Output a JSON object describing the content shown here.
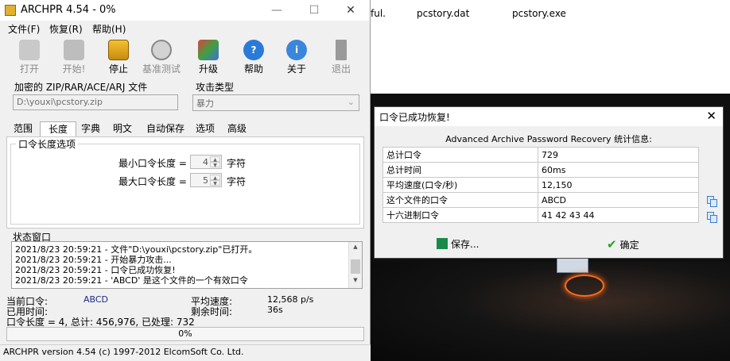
{
  "background": {
    "explorer_files": [
      "ful.",
      "pcstory.dat",
      "pcstory.exe"
    ]
  },
  "window": {
    "title": "ARCHPR 4.54 - 0%",
    "controls": {
      "minimize": "—",
      "maximize": "☐",
      "close": "✕"
    },
    "menu": [
      "文件(F)",
      "恢复(R)",
      "帮助(H)"
    ],
    "toolbar": [
      {
        "label": "打开",
        "icon": "open-folder-icon",
        "enabled": false
      },
      {
        "label": "开始!",
        "icon": "start-icon",
        "enabled": false
      },
      {
        "label": "停止",
        "icon": "stop-lock-icon",
        "enabled": true
      },
      {
        "label": "基准测试",
        "icon": "stopwatch-icon",
        "enabled": false
      },
      {
        "label": "升级",
        "icon": "upgrade-icon",
        "enabled": true
      },
      {
        "label": "帮助",
        "icon": "help-icon",
        "enabled": true
      },
      {
        "label": "关于",
        "icon": "info-icon",
        "enabled": true
      },
      {
        "label": "退出",
        "icon": "exit-door-icon",
        "enabled": false
      }
    ],
    "encrypted_file_label": "加密的 ZIP/RAR/ACE/ARJ 文件",
    "encrypted_file_value": "D:\\youxi\\pcstory.zip",
    "attack_type_label": "攻击类型",
    "attack_type_value": "暴力",
    "tabs": [
      "范围",
      "长度",
      "字典",
      "明文",
      "自动保存",
      "选项",
      "高级"
    ],
    "active_tab": "长度",
    "length_group_title": "口令长度选项",
    "min_len_label": "最小口令长度 =",
    "min_len_value": "4",
    "max_len_label": "最大口令长度 =",
    "max_len_value": "5",
    "unit_label": "字符",
    "status_window_label": "状态窗口",
    "log": [
      "2021/8/23 20:59:21 - 文件\"D:\\youxi\\pcstory.zip\"已打开。",
      "2021/8/23 20:59:21 - 开始暴力攻击...",
      "2021/8/23 20:59:21 - 口令已成功恢复!",
      "2021/8/23 20:59:21 - 'ABCD' 是这个文件的一个有效口令"
    ],
    "current_password_label": "当前口令:",
    "current_password_value": "ABCD",
    "elapsed_label": "已用时间:",
    "avg_speed_label": "平均速度:",
    "avg_speed_value": "12,568 p/s",
    "remaining_label": "剩余时间:",
    "remaining_value": "36s",
    "summary": "口令长度 = 4, 总计: 456,976, 已处理: 732",
    "progress_text": "0%",
    "progress": 0,
    "statusbar": "ARCHPR version 4.54 (c) 1997-2012 ElcomSoft Co. Ltd."
  },
  "dialog": {
    "title": "口令已成功恢复!",
    "close": "✕",
    "header": "Advanced Archive Password Recovery 统计信息:",
    "rows": [
      {
        "k": "总计口令",
        "v": "729"
      },
      {
        "k": "总计时间",
        "v": "60ms"
      },
      {
        "k": "平均速度(口令/秒)",
        "v": "12,150"
      },
      {
        "k": "这个文件的口令",
        "v": "ABCD"
      },
      {
        "k": "十六进制口令",
        "v": "41 42 43 44"
      }
    ],
    "save_label": "保存...",
    "ok_label": "确定"
  },
  "colors": {
    "accent_blue": "#1f6fd0",
    "ok_green": "#2a9d2a",
    "save_green": "#1a8a4a"
  }
}
